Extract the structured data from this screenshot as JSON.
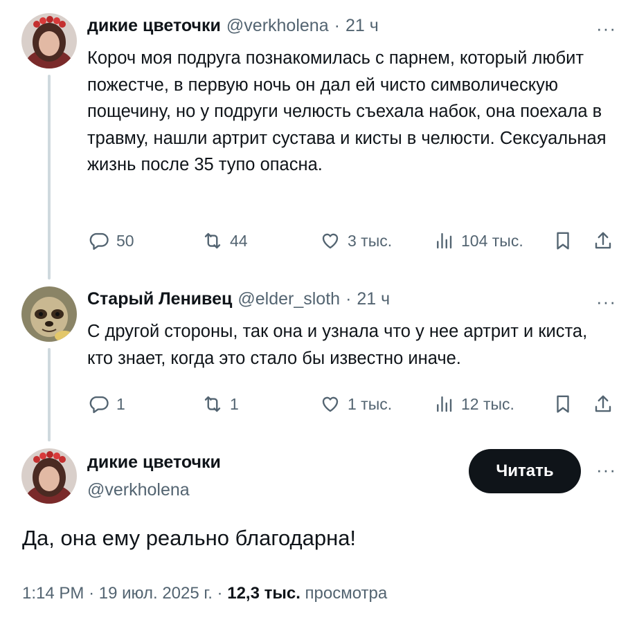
{
  "tweet1": {
    "name": "дикие цветочки",
    "handle": "@verkholena",
    "sep": "·",
    "time": "21 ч",
    "text": "Короч моя подруга познакомилась с парнем, который любит пожестче, в первую ночь он дал ей чисто символическую пощечину, но у подруги челюсть съехала набок, она поехала в травму, нашли артрит сустава и кисты в челюсти. Сексуальная жизнь после 35 тупо опасна.",
    "replies": "50",
    "reposts": "44",
    "likes": "3 тыс.",
    "views": "104 тыс."
  },
  "tweet2": {
    "name": "Старый Ленивец",
    "handle": "@elder_sloth",
    "sep": "·",
    "time": "21 ч",
    "text": "С другой стороны, так она и узнала что у нее артрит и киста, кто знает, когда это стало бы известно иначе.",
    "replies": "1",
    "reposts": "1",
    "likes": "1 тыс.",
    "views": "12 тыс."
  },
  "main": {
    "name": "дикие цветочки",
    "handle": "@verkholena",
    "follow_label": "Читать",
    "text": "Да, она ему реально благодарна!",
    "time": "1:14 PM",
    "date": "19 июл. 2025 г.",
    "sep": "·",
    "views_count": "12,3 тыс.",
    "views_label": "просмотра"
  },
  "more_label": "···",
  "icons": {
    "reply": "reply-icon",
    "repost": "repost-icon",
    "like": "heart-icon",
    "views": "views-icon",
    "bookmark": "bookmark-icon",
    "share": "share-icon",
    "more": "more-icon"
  },
  "colors": {
    "text": "#0f1419",
    "secondary": "#536471",
    "thread_line": "#cfd9de",
    "button_bg": "#0f1419"
  }
}
